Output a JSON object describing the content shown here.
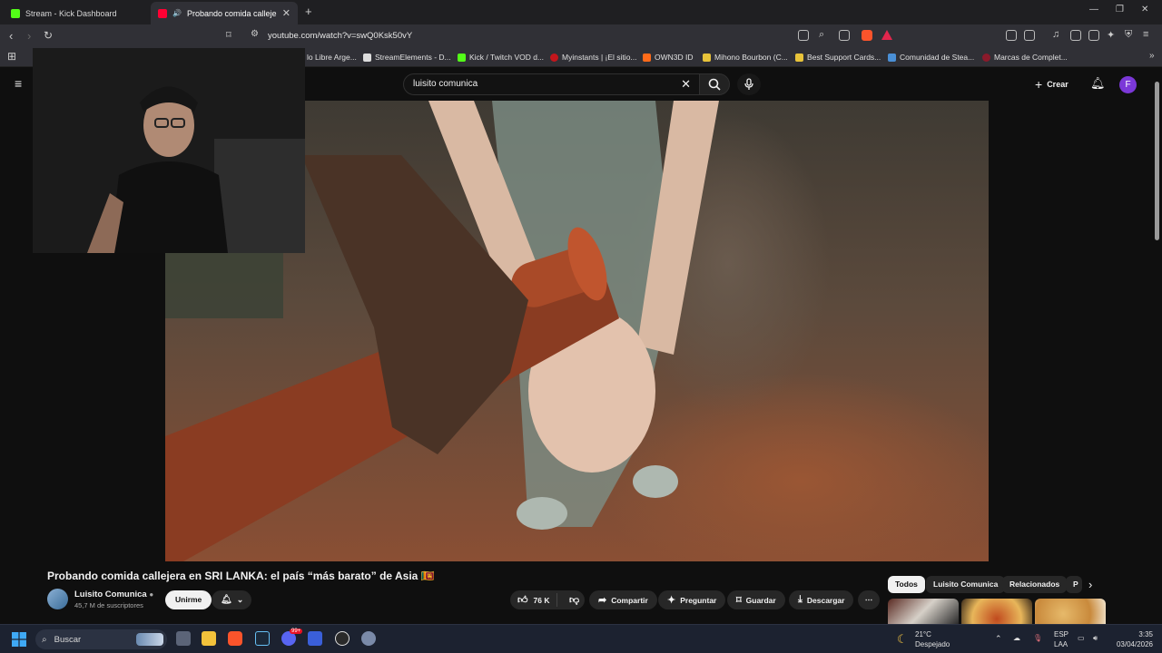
{
  "tabs": [
    {
      "label": "Stream - Kick Dashboard",
      "active": false
    },
    {
      "label": "Probando comida callejera en",
      "active": true
    }
  ],
  "address": {
    "url": "youtube.com/watch?v=swQ0Ksk50vY"
  },
  "bookmarks": [
    {
      "label": "lo Libre Arge..."
    },
    {
      "label": "StreamElements - D..."
    },
    {
      "label": "Kick / Twitch VOD d..."
    },
    {
      "label": "Myinstants | ¡El sitio..."
    },
    {
      "label": "OWN3D ID"
    },
    {
      "label": "Mihono Bourbon (C..."
    },
    {
      "label": "Best Support Cards..."
    },
    {
      "label": "Comunidad de Stea..."
    },
    {
      "label": "Marcas de Complet..."
    }
  ],
  "youtube": {
    "search_value": "luisito comunica",
    "create_label": "Crear",
    "avatar_letter": "F"
  },
  "video": {
    "title": "Probando comida callejera en SRI LANKA: el país “más barato” de Asia 🇱🇰",
    "channel": "Luisito Comunica",
    "subscribers": "45,7 M de suscriptores",
    "join_label": "Unirme",
    "likes": "76 K",
    "share_label": "Compartir",
    "ask_label": "Preguntar",
    "save_label": "Guardar",
    "download_label": "Descargar"
  },
  "chips": [
    "Todos",
    "Luisito Comunica",
    "Relacionados",
    "P"
  ],
  "taskbar": {
    "search_placeholder": "Buscar",
    "weather_temp": "21°C",
    "weather_desc": "Despejado",
    "lang_1": "ESP",
    "lang_2": "LAA",
    "time": "3:35",
    "date": "03/04/2026",
    "notif_badge": "99+"
  },
  "colors": {
    "accent_red": "#ff0033",
    "kick_green": "#53fc18",
    "avatar_purple": "#7b38d8"
  }
}
